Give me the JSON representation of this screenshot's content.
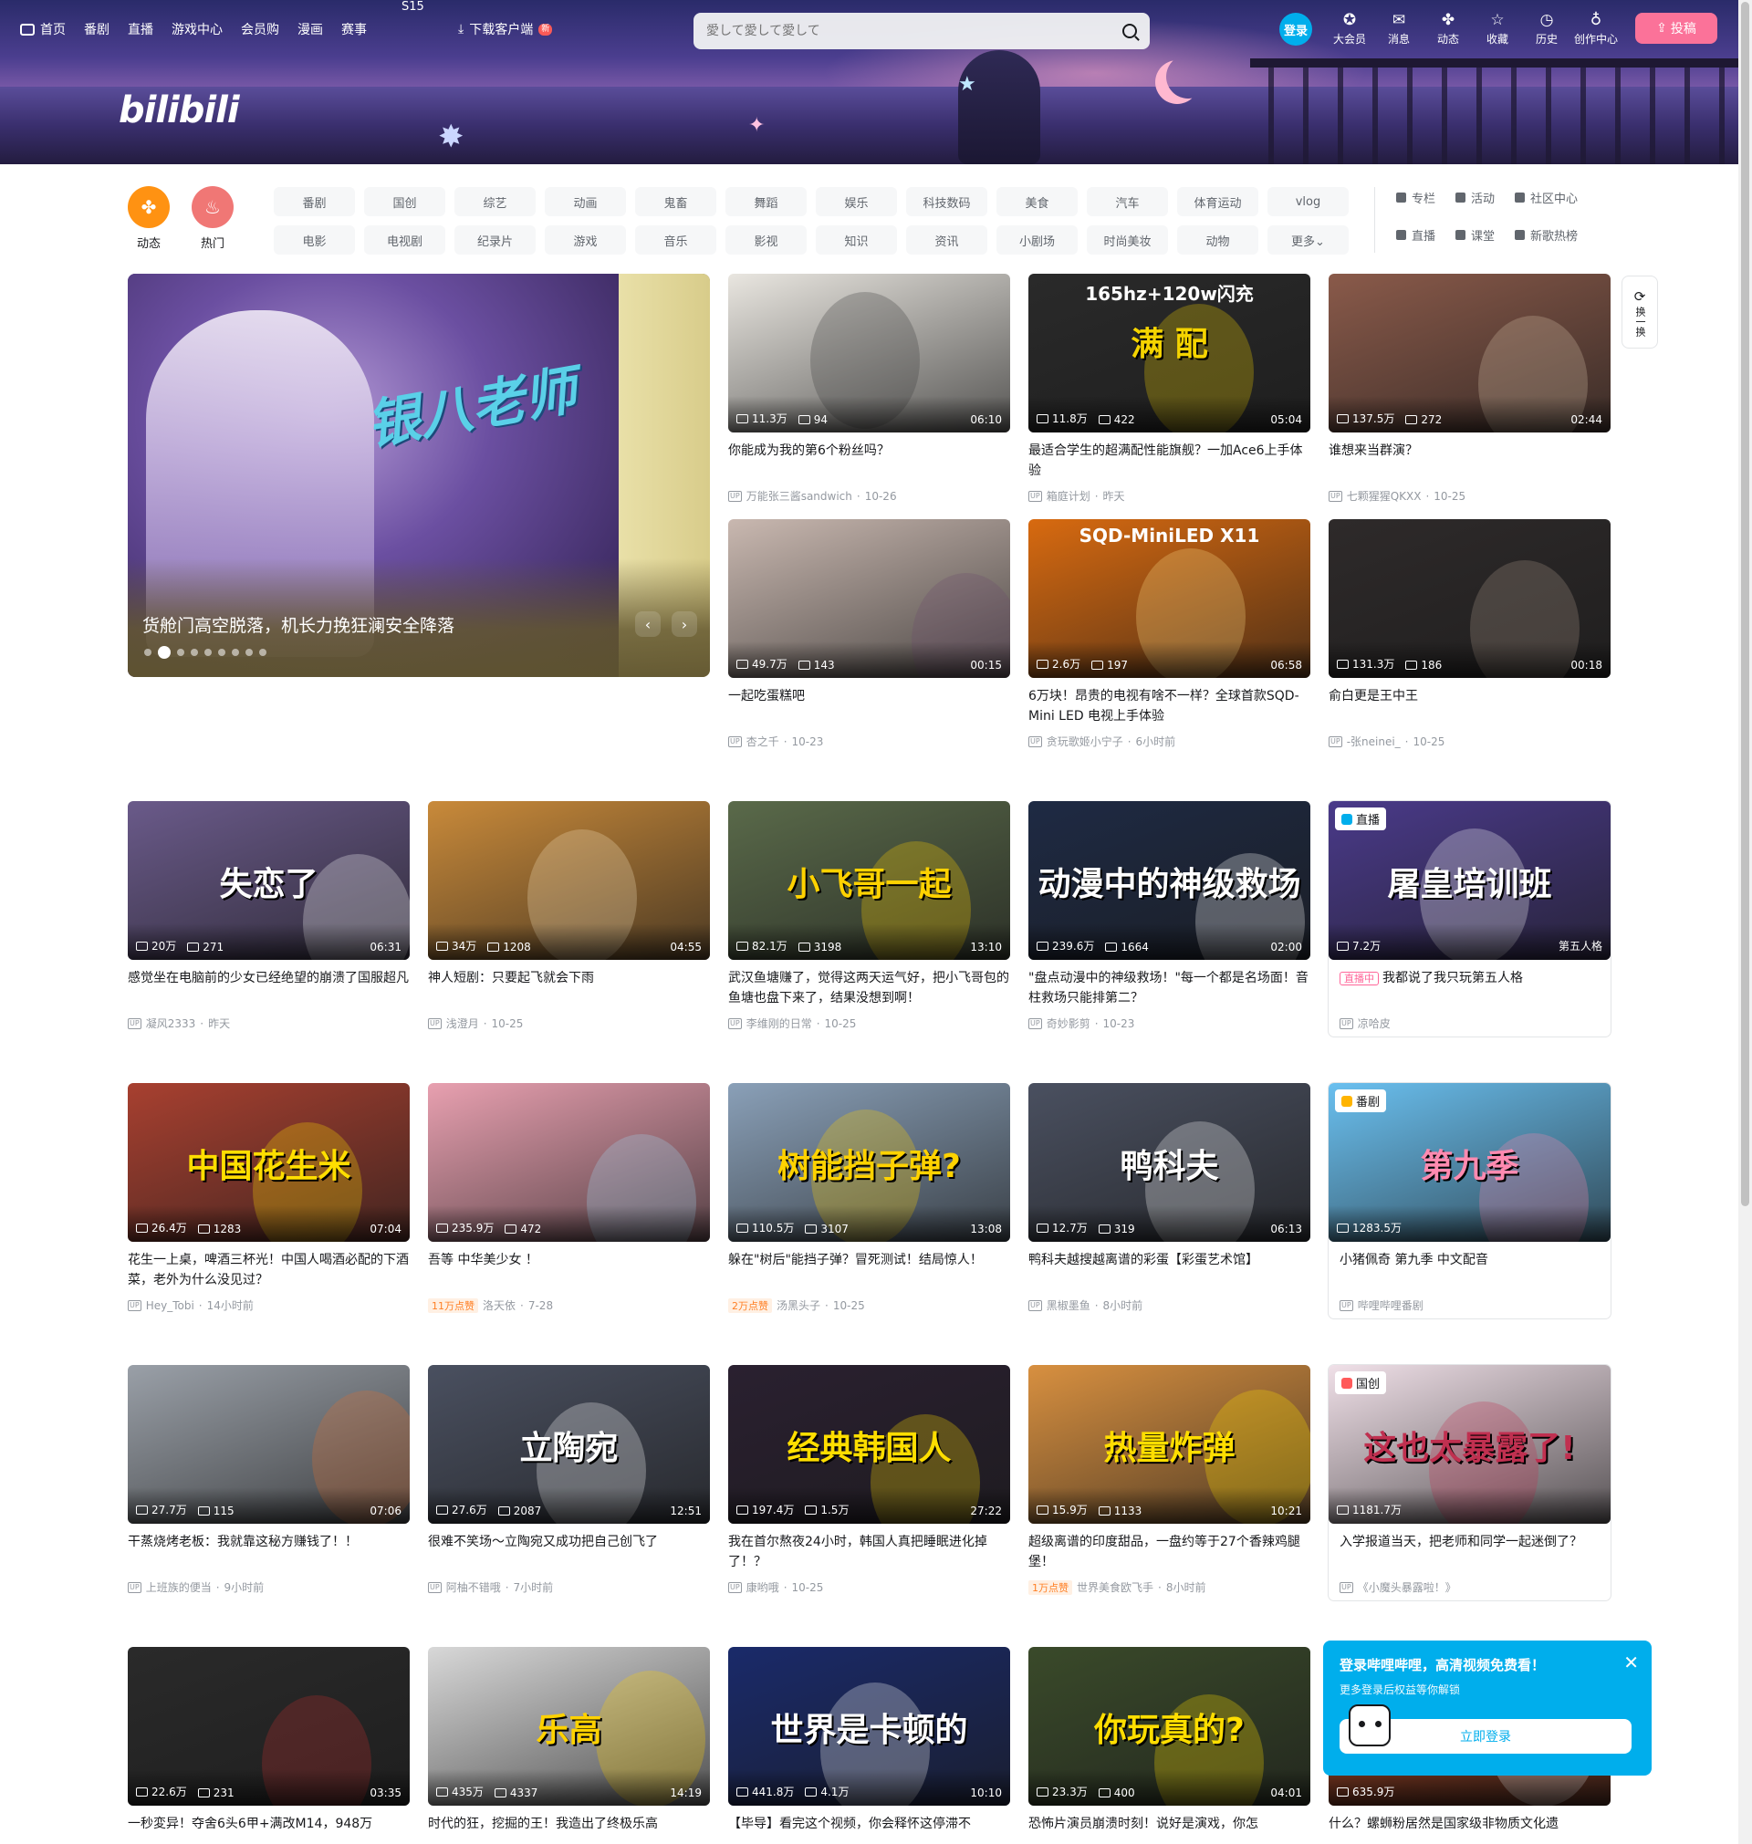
{
  "header": {
    "nav": [
      "首页",
      "番剧",
      "直播",
      "游戏中心",
      "会员购",
      "漫画",
      "赛事"
    ],
    "s15": "S15",
    "download": "下载客户端",
    "new_badge": "新",
    "search_placeholder": "愛して愛して愛して",
    "login": "登录",
    "right_nav": [
      {
        "icon": "vip-icon",
        "glyph": "✪",
        "label": "大会员"
      },
      {
        "icon": "message-icon",
        "glyph": "✉",
        "label": "消息"
      },
      {
        "icon": "dynamic-icon",
        "glyph": "✤",
        "label": "动态"
      },
      {
        "icon": "favorite-icon",
        "glyph": "☆",
        "label": "收藏"
      },
      {
        "icon": "history-icon",
        "glyph": "◷",
        "label": "历史"
      },
      {
        "icon": "creator-icon",
        "glyph": "♁",
        "label": "创作中心"
      }
    ],
    "upload": "投稿",
    "logo": "bilibili"
  },
  "channels": {
    "icons": [
      {
        "label": "动态",
        "glyph": "✤",
        "color": "#ff9212"
      },
      {
        "label": "热门",
        "glyph": "♨",
        "color": "#f07775"
      }
    ],
    "tags": [
      "番剧",
      "国创",
      "综艺",
      "动画",
      "鬼畜",
      "舞蹈",
      "娱乐",
      "科技数码",
      "美食",
      "汽车",
      "体育运动",
      "vlog",
      "电影",
      "电视剧",
      "纪录片",
      "游戏",
      "音乐",
      "影视",
      "知识",
      "资讯",
      "小剧场",
      "时尚美妆",
      "动物",
      "更多⌄"
    ],
    "side_links": [
      "专栏",
      "活动",
      "社区中心",
      "直播",
      "课堂",
      "新歌热榜"
    ]
  },
  "carousel": {
    "caption": "货舱门高空脱落，机长力挽狂澜安全降落",
    "logo_text": "银八老师",
    "dots": 9,
    "active_dot": 1
  },
  "refresh_label": "换一换",
  "cards": [
    {
      "title": "你能成为我的第6个粉丝吗？",
      "views": "11.3万",
      "danmaku": "94",
      "duration": "06:10",
      "author": "万能张三酱sandwich",
      "date": "10-26",
      "bg": "#e9e6e0",
      "accent": "#3a3a3a"
    },
    {
      "title": "最适合学生的超满配性能旗舰？一加Ace6上手体验",
      "views": "11.8万",
      "danmaku": "422",
      "duration": "05:04",
      "author": "箱庭计划",
      "date": "昨天",
      "bg": "#2a2a2a",
      "accent": "#f5d400",
      "overlay": "满  配",
      "overlay2": "165hz+120w闪充"
    },
    {
      "title": "谁想来当群演？",
      "views": "137.5万",
      "danmaku": "272",
      "duration": "02:44",
      "author": "七颗猩猩QKXX",
      "date": "10-25",
      "bg": "#8a5a4a",
      "accent": "#d9c2a8"
    },
    {
      "title": "一起吃蛋糕吧",
      "views": "49.7万",
      "danmaku": "143",
      "duration": "00:15",
      "author": "杏之千",
      "date": "10-23",
      "bg": "#c9b8b0",
      "accent": "#6b4a6b"
    },
    {
      "title": "6万块！昂贵的电视有啥不一样？全球首款SQD-Mini LED 电视上手体验",
      "views": "2.6万",
      "danmaku": "197",
      "duration": "06:58",
      "author": "贪玩歌姬小宁子",
      "date": "6小时前",
      "bg": "#d86a10",
      "accent": "#ffe08a",
      "overlay2": "SQD-MiniLED X11"
    },
    {
      "title": "俞白更是王中王",
      "views": "131.3万",
      "danmaku": "186",
      "duration": "00:18",
      "author": "-张neinei_",
      "date": "10-25",
      "bg": "#2e2a2a",
      "accent": "#a8968a"
    },
    {
      "title": "感觉坐在电脑前的少女已经绝望的崩溃了国服超凡",
      "views": "20万",
      "danmaku": "271",
      "duration": "06:31",
      "author": "凝风2333",
      "date": "昨天",
      "bg": "#6a5a8a",
      "accent": "#ffffff",
      "overlay": "失恋了"
    },
    {
      "title": "神人短剧：只要起飞就会下雨",
      "views": "34万",
      "danmaku": "1208",
      "duration": "04:55",
      "author": "浅澄月",
      "date": "10-25",
      "bg": "#c98a3a",
      "accent": "#f3e3c0"
    },
    {
      "title": "武汉鱼塘赚了，觉得这两天运气好，把小飞哥包的鱼塘也盘下来了，结果没想到啊！",
      "views": "82.1万",
      "danmaku": "3198",
      "duration": "13:10",
      "author": "李维刚的日常",
      "date": "10-25",
      "bg": "#5a6a4a",
      "accent": "#ffd200",
      "overlay": "小飞哥一起"
    },
    {
      "title": "\"盘点动漫中的神级救场！\"每一个都是名场面！音柱救场只能排第二？",
      "views": "239.6万",
      "danmaku": "1664",
      "duration": "02:00",
      "author": "奇妙影剪",
      "date": "10-23",
      "bg": "#1e2a44",
      "accent": "#ffffff",
      "overlay": "动漫中的神级救场"
    },
    {
      "title": "我都说了我只玩第五人格",
      "views": "7.2万",
      "danmaku": "",
      "duration": "第五人格",
      "author": "凉哈皮",
      "date": "",
      "bg": "#4a3a8a",
      "accent": "#ffffff",
      "overlay": "屠皇培训班",
      "special": "直播",
      "live": "直播中"
    },
    {
      "title": "花生一上桌，啤酒三杯光！中国人喝酒必配的下酒菜，老外为什么没见过？",
      "views": "26.4万",
      "danmaku": "1283",
      "duration": "07:04",
      "author": "Hey_Tobi",
      "date": "14小时前",
      "bg": "#a84030",
      "accent": "#ffde00",
      "overlay": "中国花生米"
    },
    {
      "title": "吾等 中华美少女 ！",
      "views": "235.9万",
      "danmaku": "472",
      "duration": "",
      "author": "洛天依",
      "date": "7-28",
      "bg": "#e8a0b0",
      "accent": "#a0d8f0",
      "hot": "11万点赞"
    },
    {
      "title": "躲在\"树后\"能挡子弹？冒死测试！结局惊人！",
      "views": "110.5万",
      "danmaku": "3107",
      "duration": "13:08",
      "author": "汤黑头子",
      "date": "10-25",
      "bg": "#8aa0b8",
      "accent": "#ffd200",
      "overlay": "树能挡子弹?",
      "hot": "2万点赞"
    },
    {
      "title": "鸭科夫越搜越离谱的彩蛋【彩蛋艺术馆】",
      "views": "12.7万",
      "danmaku": "319",
      "duration": "06:13",
      "author": "黑椒墨鱼",
      "date": "8小时前",
      "bg": "#4a5060",
      "accent": "#ffffff",
      "overlay": "鸭科夫"
    },
    {
      "title": "小猪佩奇 第九季 中文配音",
      "views": "1283.5万",
      "danmaku": "",
      "duration": "",
      "author": "哔哩哔哩番剧",
      "date": "",
      "bg": "#6ac0f0",
      "accent": "#ff8ab0",
      "overlay": "第九季",
      "special": "番剧"
    },
    {
      "title": "干蒸烧烤老板：我就靠这秘方赚钱了！！",
      "views": "27.7万",
      "danmaku": "115",
      "duration": "07:06",
      "author": "上班族的便当",
      "date": "9小时前",
      "bg": "#9aa0a8",
      "accent": "#e07030"
    },
    {
      "title": "很难不笑场～立陶宛又成功把自己创飞了",
      "views": "27.6万",
      "danmaku": "2087",
      "duration": "12:51",
      "author": "阿柚不错哦",
      "date": "7小时前",
      "bg": "#4a5060",
      "accent": "#ffffff",
      "overlay": "立陶宛"
    },
    {
      "title": "我在首尔熬夜24小时，韩国人真把睡眠进化掉了！？",
      "views": "197.4万",
      "danmaku": "1.5万",
      "duration": "27:22",
      "author": "康哟哦",
      "date": "10-25",
      "bg": "#2a2030",
      "accent": "#ffde00",
      "overlay": "经典韩国人"
    },
    {
      "title": "超级离谱的印度甜品，一盘约等于27个香辣鸡腿堡！",
      "views": "15.9万",
      "danmaku": "1133",
      "duration": "10:21",
      "author": "世界美食欧飞手",
      "date": "8小时前",
      "bg": "#d89040",
      "accent": "#ffde00",
      "overlay": "热量炸弹",
      "hot": "1万点赞"
    },
    {
      "title": "入学报道当天，把老师和同学一起迷倒了？",
      "views": "1181.7万",
      "danmaku": "",
      "duration": "",
      "author": "《小魔头暴露啦！》",
      "date": "",
      "bg": "#f0e0e8",
      "accent": "#c03050",
      "overlay": "这也太暴露了!",
      "special": "国创"
    },
    {
      "title": "一秒変异！夺舍6头6甲+满改M14，948万",
      "views": "22.6万",
      "danmaku": "231",
      "duration": "03:35",
      "author": "",
      "date": "",
      "bg": "#2a2a2a",
      "accent": "#c03030"
    },
    {
      "title": "时代的狂，挖掘的王！我造出了终极乐高",
      "views": "435万",
      "danmaku": "4337",
      "duration": "14:19",
      "author": "",
      "date": "",
      "bg": "#d8d8d8",
      "accent": "#ffd200",
      "overlay": "乐高"
    },
    {
      "title": "【毕导】看完这个视频，你会释怀这停滞不",
      "views": "441.8万",
      "danmaku": "4.1万",
      "duration": "10:10",
      "author": "",
      "date": "",
      "bg": "#1a2a6a",
      "accent": "#ffffff",
      "overlay": "世界是卡顿的"
    },
    {
      "title": "恐怖片演员崩溃时刻！说好是演戏，你怎",
      "views": "23.3万",
      "danmaku": "400",
      "duration": "04:01",
      "author": "",
      "date": "",
      "bg": "#3a4a2a",
      "accent": "#ffde00",
      "overlay": "你玩真的?"
    },
    {
      "title": "什么？螺蛳粉居然是国家级非物质文化遗",
      "views": "635.9万",
      "danmaku": "",
      "duration": "",
      "author": "",
      "date": "",
      "bg": "#a04020",
      "accent": "#ffffff"
    }
  ],
  "popup": {
    "title": "登录哔哩哔哩，高清视频免费看！",
    "subtitle": "更多登录后权益等你解锁",
    "button": "立即登录"
  }
}
